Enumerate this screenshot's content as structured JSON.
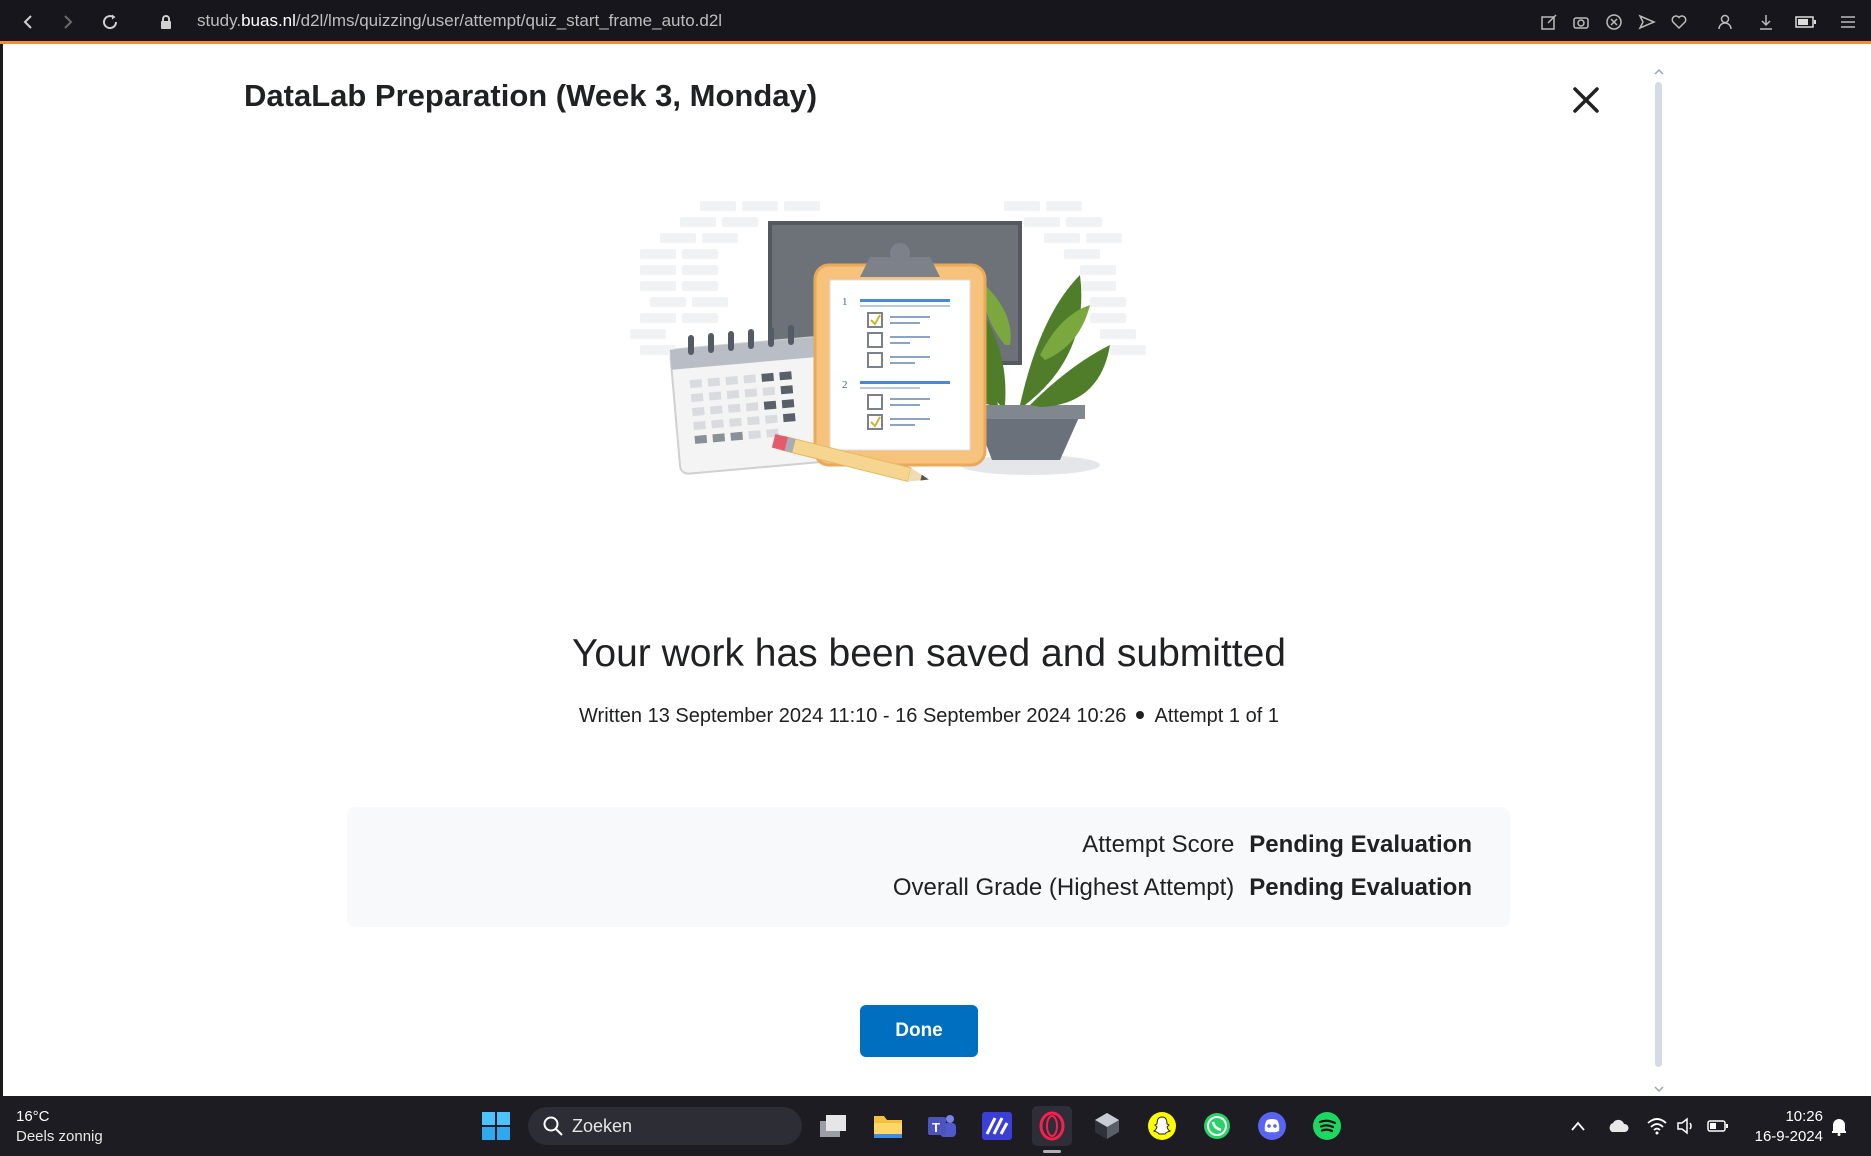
{
  "browser": {
    "url_prefix": "study.",
    "url_domain": "buas.nl",
    "url_path": "/d2l/lms/quizzing/user/attempt/quiz_start_frame_auto.d2l"
  },
  "dialog": {
    "title": "DataLab Preparation (Week 3, Monday)",
    "headline": "Your work has been saved and submitted",
    "written": "Written 13 September 2024 11:10 - 16 September 2024 10:26",
    "attempt": "Attempt 1 of 1",
    "scores": [
      {
        "label": "Attempt Score",
        "value": "Pending Evaluation"
      },
      {
        "label": "Overall Grade (Highest Attempt)",
        "value": "Pending Evaluation"
      }
    ],
    "done_label": "Done"
  },
  "illustration": {
    "clipboard_numbers": [
      "1",
      "2"
    ]
  },
  "taskbar": {
    "weather_temp": "16°C",
    "weather_desc": "Deels zonnig",
    "search_placeholder": "Zoeken",
    "time": "10:26",
    "date": "16-9-2024"
  },
  "colors": {
    "accent": "#006fbf",
    "browser_border": "#f08c3a"
  }
}
